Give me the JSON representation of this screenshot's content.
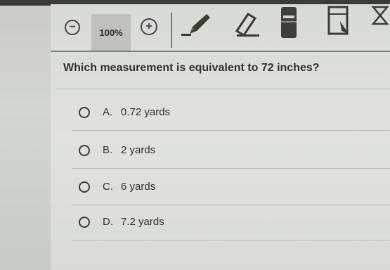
{
  "toolbar": {
    "zoom_level": "100%",
    "tools": [
      "zoom-out-icon",
      "zoom-in-icon",
      "pencil-icon",
      "eraser-icon",
      "calculator-icon",
      "notepad-icon",
      "flag-icon"
    ]
  },
  "question": {
    "text": "Which measurement is equivalent to 72 inches?"
  },
  "choices": [
    {
      "letter": "A.",
      "text": "0.72 yards"
    },
    {
      "letter": "B.",
      "text": "2 yards"
    },
    {
      "letter": "C.",
      "text": "6 yards"
    },
    {
      "letter": "D.",
      "text": "7.2 yards"
    }
  ]
}
